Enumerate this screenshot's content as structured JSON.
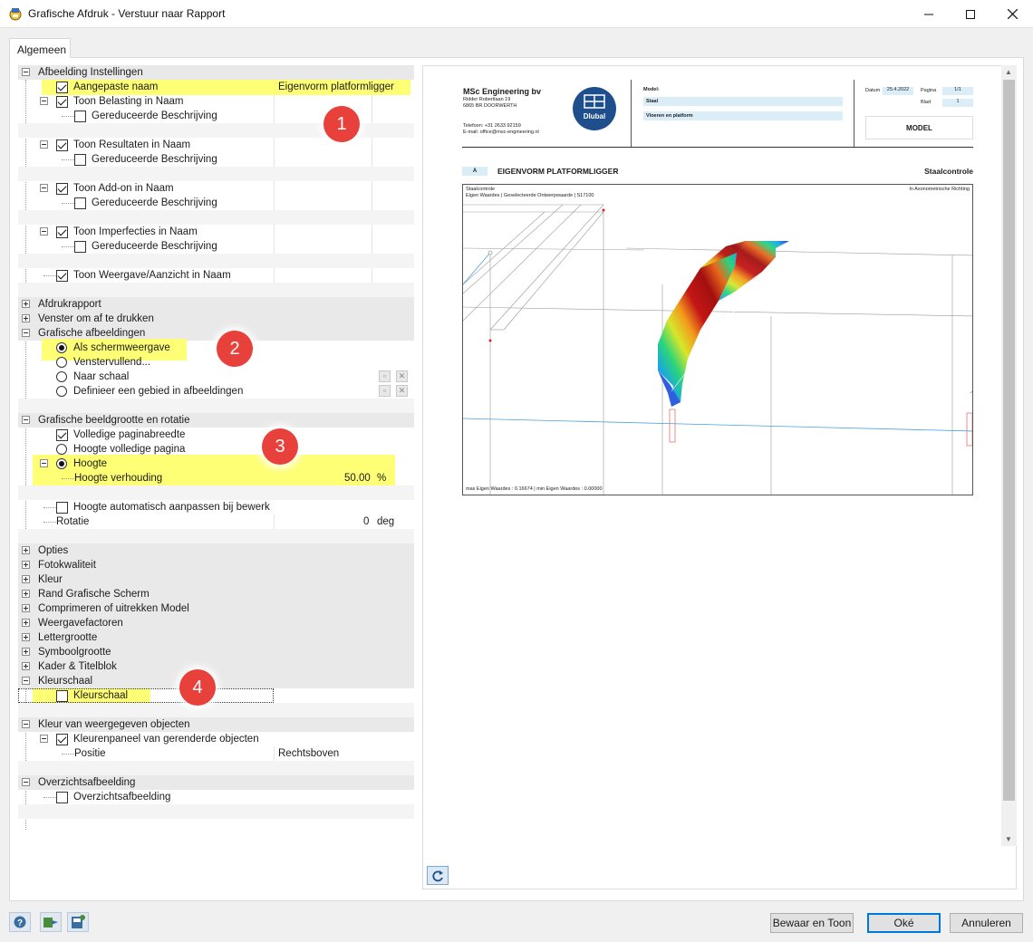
{
  "window": {
    "title": "Grafische Afdruk - Verstuur naar Rapport"
  },
  "tab": {
    "label": "Algemeen"
  },
  "tree": {
    "afbeelding_instellingen": "Afbeelding Instellingen",
    "aangepaste_naam": "Aangepaste naam",
    "aangepaste_naam_value": "Eigenvorm platformligger",
    "toon_belasting": "Toon Belasting in Naam",
    "gereduceerde1": "Gereduceerde Beschrijving",
    "toon_resultaten": "Toon Resultaten in Naam",
    "gereduceerde2": "Gereduceerde Beschrijving",
    "toon_addon": "Toon Add-on in Naam",
    "gereduceerde3": "Gereduceerde Beschrijving",
    "toon_imperfecties": "Toon Imperfecties in Naam",
    "gereduceerde4": "Gereduceerde Beschrijving",
    "toon_weergave": "Toon Weergave/Aanzicht in Naam",
    "afdrukrapport": "Afdrukrapport",
    "venster": "Venster om af te drukken",
    "grafische_afbeeldingen": "Grafische afbeeldingen",
    "als_scherm": "Als schermweergave",
    "venstervullend": "Venstervullend...",
    "naar_schaal": "Naar schaal",
    "definieer_gebied": "Definieer een gebied in afbeeldingen",
    "beeldgrootte": "Grafische beeldgrootte en rotatie",
    "volledige_breedte": "Volledige paginabreedte",
    "hoogte_volledig": "Hoogte volledige pagina",
    "hoogte": "Hoogte",
    "hoogte_verhouding": "Hoogte verhouding",
    "hoogte_verhouding_value": "50.00",
    "hoogte_verhouding_unit": "%",
    "hoogte_auto": "Hoogte automatisch aanpassen bij bewerk",
    "rotatie": "Rotatie",
    "rotatie_value": "0",
    "rotatie_unit": "deg",
    "opties": "Opties",
    "fotokwaliteit": "Fotokwaliteit",
    "kleur": "Kleur",
    "rand": "Rand Grafische Scherm",
    "comprimeren": "Comprimeren of uitrekken Model",
    "weergavefactoren": "Weergavefactoren",
    "lettergrootte": "Lettergrootte",
    "symboolgrootte": "Symboolgrootte",
    "kader": "Kader & Titelblok",
    "kleurschaal_group": "Kleurschaal",
    "kleurschaal_item": "Kleurschaal",
    "kleur_weergegeven": "Kleur van weergegeven objecten",
    "kleurenpaneel": "Kleurenpaneel van gerenderde objecten",
    "positie": "Positie",
    "positie_value": "Rechtsboven",
    "overzicht_group": "Overzichtsafbeelding",
    "overzicht_item": "Overzichtsafbeelding"
  },
  "badges": [
    "1",
    "2",
    "3",
    "4"
  ],
  "report": {
    "company": "MSc Engineering bv",
    "address1": "Ridder Robertlaan 19",
    "address2": "6865 BR DOORWERTH",
    "phone": "Telefoon: +31 2633 92159",
    "email": "E-mail: office@msc-engineering.nl",
    "logo_text": "Dlubal",
    "model_label": "Model:",
    "model_field1": "Staal",
    "model_field2": "Vloeren en platform",
    "datum_label": "Datum",
    "datum_value": "25.4.2022",
    "pagina_label": "Pagina",
    "pagina_value": "1/1",
    "blad_label": "Blad",
    "blad_value": "1",
    "model_box": "MODEL",
    "section_letter": "A",
    "section_title": "EIGENVORM PLATFORMLIGGER",
    "section_right": "Staalcontrole",
    "fig_line1": "Staalcontrole",
    "fig_line2": "Eigen Waardes | Geselecteerde Ontwerpwaarde | S17100",
    "fig_right": "In Axonometrische Richting",
    "fig_footer": "max Eigen Waardes : 0.16674 | min Eigen Waardes : 0.00000"
  },
  "buttons": {
    "bewaar": "Bewaar en Toon",
    "oke": "Oké",
    "annuleren": "Annuleren"
  },
  "colors": {
    "highlight": "#ffff66",
    "badge": "#e8403a",
    "accent": "#0078d7",
    "logo": "#1f4e8c"
  }
}
